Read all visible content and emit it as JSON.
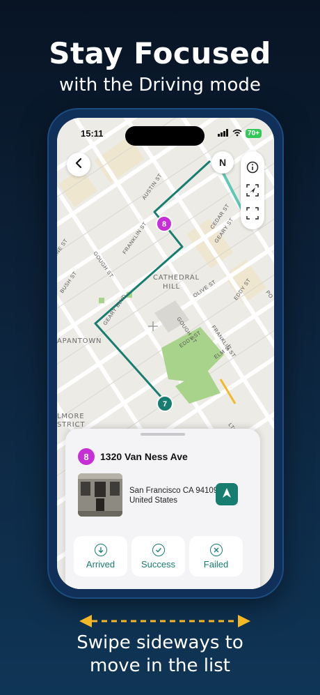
{
  "headline": {
    "title": "Stay Focused",
    "subtitle": "with the Driving mode"
  },
  "status_bar": {
    "time": "15:11",
    "battery": "70+"
  },
  "map": {
    "compass": "N",
    "labels": {
      "cathedral": "CATHEDRAL",
      "hill": "HILL",
      "japantown": "APANTOWN",
      "gough_top": "GOUGH ST",
      "gough_mid": "GOUGH ST",
      "franklin_top": "FRANKLIN ST",
      "franklin_mid": "FRANKLIN ST",
      "bush": "BUSH ST",
      "geary": "GEARY BLVD",
      "austin": "AUSTIN ST",
      "cedar": "CEDAR ST",
      "geary_st": "GEARY ST",
      "olive": "OLIVE ST",
      "eddy": "EDDY ST",
      "eddy2": "EDDY ST",
      "elm": "ELM ST",
      "fillmore": "LMORE",
      "district": "STRICT",
      "hilton": "LTON ST",
      "line": "INE ST",
      "po": "PO"
    },
    "markers": [
      {
        "label": "8"
      },
      {
        "label": "7"
      }
    ]
  },
  "card": {
    "stop_number": "8",
    "stop_title": "1320 Van Ness Ave",
    "address_line1": "San Francisco CA 94109",
    "address_line2": "United States",
    "actions": [
      {
        "label": "Arrived",
        "icon": "arrow-down-circle-icon"
      },
      {
        "label": "Success",
        "icon": "checkmark-circle-icon"
      },
      {
        "label": "Failed",
        "icon": "x-circle-icon"
      }
    ]
  },
  "footer": {
    "line1": "Swipe sideways to",
    "line2": "move in the list"
  },
  "colors": {
    "route": "#167d6f",
    "stop": "#c72fd6",
    "park": "#a8d38a",
    "gold": "#f2b826"
  }
}
